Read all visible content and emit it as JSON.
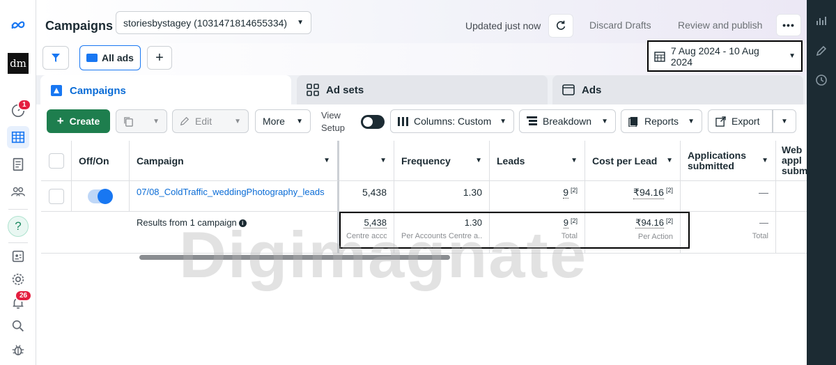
{
  "header": {
    "title": "Campaigns",
    "account": "storiesbystagey (1031471814655334)",
    "updated": "Updated just now",
    "discard": "Discard Drafts",
    "review": "Review and publish",
    "more": "•••"
  },
  "nav": {
    "brand_initials": "dm",
    "alerts_badge": "1",
    "notifications_badge": "26",
    "help": "?"
  },
  "toolbar": {
    "all_ads": "All ads",
    "add_view": "+",
    "date_range": "7 Aug 2024 - 10 Aug 2024"
  },
  "tabs": [
    {
      "label": "Campaigns",
      "icon": "campaigns-icon"
    },
    {
      "label": "Ad sets",
      "icon": "ad-sets-icon"
    },
    {
      "label": "Ads",
      "icon": "ads-icon"
    }
  ],
  "actions": {
    "create": "Create",
    "edit": "Edit",
    "more": "More",
    "view_setup_line1": "View",
    "view_setup_line2": "Setup",
    "columns": "Columns: Custom",
    "breakdown": "Breakdown",
    "reports": "Reports",
    "export": "Export"
  },
  "table": {
    "headers": {
      "off_on": "Off/On",
      "campaign": "Campaign",
      "frequency": "Frequency",
      "leads": "Leads",
      "cost_per_lead": "Cost per Lead",
      "applications_1": "Applications",
      "applications_2": "submitted",
      "web_1": "Web",
      "web_2": "appl",
      "web_3": "subm"
    },
    "row": {
      "campaign": "07/08_ColdTraffic_weddingPhotography_leads",
      "reach": "5,438",
      "frequency": "1.30",
      "leads": "9",
      "leads_note": "[2]",
      "cost_per_lead": "₹94.16",
      "cpl_note": "[2]",
      "applications": "—"
    },
    "footer": {
      "label": "Results from 1 campaign",
      "reach": "5,438",
      "reach_sub": "Centre accou...",
      "frequency": "1.30",
      "frequency_sub": "Per Accounts Centre a...",
      "leads": "9",
      "leads_note": "[2]",
      "leads_sub": "Total",
      "cost_per_lead": "₹94.16",
      "cpl_note": "[2]",
      "cpl_sub": "Per Action",
      "applications": "—",
      "applications_sub": "Total"
    }
  },
  "watermark": "Digimagnate",
  "colors": {
    "accent": "#1877f2",
    "create": "#1e7e4e",
    "badge": "#e41e3f",
    "rightstrip": "#1c2b33"
  }
}
